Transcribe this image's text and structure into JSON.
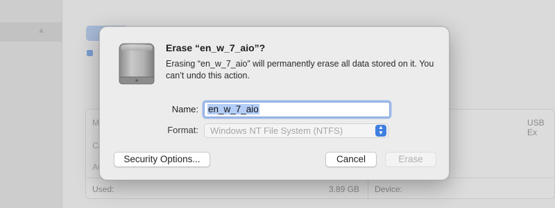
{
  "background": {
    "info_labels_left": [
      "M",
      "Ca",
      "Av"
    ],
    "used_label": "Used:",
    "used_value": "3.89 GB",
    "device_label": "Device:",
    "connection_value": "USB Ex"
  },
  "dialog": {
    "icon": "external-drive-icon",
    "title": "Erase “en_w_7_aio”?",
    "message": "Erasing “en_w_7_aio” will permanently erase all data stored on it. You can’t undo this action.",
    "name_label": "Name:",
    "name_value": "en_w_7_aio",
    "format_label": "Format:",
    "format_value": "Windows NT File System (NTFS)",
    "security_button": "Security Options...",
    "cancel_button": "Cancel",
    "erase_button": "Erase"
  },
  "colors": {
    "accent": "#3f7fe0",
    "selection": "#b3cdf6",
    "focus_ring": "#6092e6"
  }
}
